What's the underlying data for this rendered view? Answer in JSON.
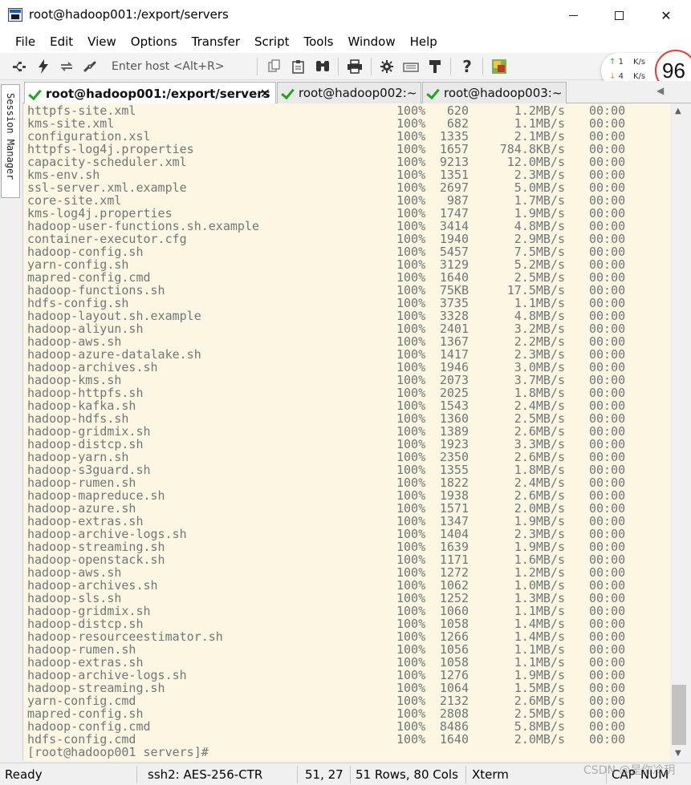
{
  "window": {
    "title": "root@hadoop001:/export/servers",
    "controls": {
      "minimize": "minimize",
      "maximize": "maximize",
      "close": "✕"
    }
  },
  "menu": [
    "File",
    "Edit",
    "View",
    "Options",
    "Transfer",
    "Script",
    "Tools",
    "Window",
    "Help"
  ],
  "toolbar": {
    "host_placeholder": "Enter host <Alt+R>",
    "icons": [
      "connect-icon",
      "quick-connect-icon",
      "reconnect-icon",
      "disconnect-icon",
      "copy-icon",
      "paste-icon",
      "find-icon",
      "print-icon",
      "settings-icon",
      "keymap-icon",
      "sftp-icon",
      "help-icon",
      "sessions-icon"
    ]
  },
  "network": {
    "up_value": "1",
    "up_unit": "K/s",
    "down_value": "4",
    "down_unit": "K/s",
    "gauge": "96"
  },
  "tabs": [
    {
      "label": "root@hadoop001:/export/servers",
      "active": true,
      "close": "✕"
    },
    {
      "label": "root@hadoop002:~",
      "active": false
    },
    {
      "label": "root@hadoop003:~",
      "active": false
    }
  ],
  "session_manager": {
    "label": "Session Manager"
  },
  "terminal": {
    "rows": [
      {
        "name": "httpfs-site.xml",
        "pct": "100%",
        "size": "620",
        "rate": "1.2MB/s",
        "time": "00:00"
      },
      {
        "name": "kms-site.xml",
        "pct": "100%",
        "size": "682",
        "rate": "1.1MB/s",
        "time": "00:00"
      },
      {
        "name": "configuration.xsl",
        "pct": "100%",
        "size": "1335",
        "rate": "2.1MB/s",
        "time": "00:00"
      },
      {
        "name": "httpfs-log4j.properties",
        "pct": "100%",
        "size": "1657",
        "rate": "784.8KB/s",
        "time": "00:00"
      },
      {
        "name": "capacity-scheduler.xml",
        "pct": "100%",
        "size": "9213",
        "rate": "12.0MB/s",
        "time": "00:00"
      },
      {
        "name": "kms-env.sh",
        "pct": "100%",
        "size": "1351",
        "rate": "2.3MB/s",
        "time": "00:00"
      },
      {
        "name": "ssl-server.xml.example",
        "pct": "100%",
        "size": "2697",
        "rate": "5.0MB/s",
        "time": "00:00"
      },
      {
        "name": "core-site.xml",
        "pct": "100%",
        "size": "987",
        "rate": "1.7MB/s",
        "time": "00:00"
      },
      {
        "name": "kms-log4j.properties",
        "pct": "100%",
        "size": "1747",
        "rate": "1.9MB/s",
        "time": "00:00"
      },
      {
        "name": "hadoop-user-functions.sh.example",
        "pct": "100%",
        "size": "3414",
        "rate": "4.8MB/s",
        "time": "00:00"
      },
      {
        "name": "container-executor.cfg",
        "pct": "100%",
        "size": "1940",
        "rate": "2.9MB/s",
        "time": "00:00"
      },
      {
        "name": "hadoop-config.sh",
        "pct": "100%",
        "size": "5457",
        "rate": "7.5MB/s",
        "time": "00:00"
      },
      {
        "name": "yarn-config.sh",
        "pct": "100%",
        "size": "3129",
        "rate": "5.2MB/s",
        "time": "00:00"
      },
      {
        "name": "mapred-config.cmd",
        "pct": "100%",
        "size": "1640",
        "rate": "2.5MB/s",
        "time": "00:00"
      },
      {
        "name": "hadoop-functions.sh",
        "pct": "100%",
        "size": "75KB",
        "rate": "17.5MB/s",
        "time": "00:00"
      },
      {
        "name": "hdfs-config.sh",
        "pct": "100%",
        "size": "3735",
        "rate": "1.1MB/s",
        "time": "00:00"
      },
      {
        "name": "hadoop-layout.sh.example",
        "pct": "100%",
        "size": "3328",
        "rate": "4.8MB/s",
        "time": "00:00"
      },
      {
        "name": "hadoop-aliyun.sh",
        "pct": "100%",
        "size": "2401",
        "rate": "3.2MB/s",
        "time": "00:00"
      },
      {
        "name": "hadoop-aws.sh",
        "pct": "100%",
        "size": "1367",
        "rate": "2.2MB/s",
        "time": "00:00"
      },
      {
        "name": "hadoop-azure-datalake.sh",
        "pct": "100%",
        "size": "1417",
        "rate": "2.3MB/s",
        "time": "00:00"
      },
      {
        "name": "hadoop-archives.sh",
        "pct": "100%",
        "size": "1946",
        "rate": "3.0MB/s",
        "time": "00:00"
      },
      {
        "name": "hadoop-kms.sh",
        "pct": "100%",
        "size": "2073",
        "rate": "3.7MB/s",
        "time": "00:00"
      },
      {
        "name": "hadoop-httpfs.sh",
        "pct": "100%",
        "size": "2025",
        "rate": "1.8MB/s",
        "time": "00:00"
      },
      {
        "name": "hadoop-kafka.sh",
        "pct": "100%",
        "size": "1543",
        "rate": "2.4MB/s",
        "time": "00:00"
      },
      {
        "name": "hadoop-hdfs.sh",
        "pct": "100%",
        "size": "1360",
        "rate": "2.5MB/s",
        "time": "00:00"
      },
      {
        "name": "hadoop-gridmix.sh",
        "pct": "100%",
        "size": "1389",
        "rate": "2.6MB/s",
        "time": "00:00"
      },
      {
        "name": "hadoop-distcp.sh",
        "pct": "100%",
        "size": "1923",
        "rate": "3.3MB/s",
        "time": "00:00"
      },
      {
        "name": "hadoop-yarn.sh",
        "pct": "100%",
        "size": "2350",
        "rate": "2.6MB/s",
        "time": "00:00"
      },
      {
        "name": "hadoop-s3guard.sh",
        "pct": "100%",
        "size": "1355",
        "rate": "1.8MB/s",
        "time": "00:00"
      },
      {
        "name": "hadoop-rumen.sh",
        "pct": "100%",
        "size": "1822",
        "rate": "2.4MB/s",
        "time": "00:00"
      },
      {
        "name": "hadoop-mapreduce.sh",
        "pct": "100%",
        "size": "1938",
        "rate": "2.6MB/s",
        "time": "00:00"
      },
      {
        "name": "hadoop-azure.sh",
        "pct": "100%",
        "size": "1571",
        "rate": "2.0MB/s",
        "time": "00:00"
      },
      {
        "name": "hadoop-extras.sh",
        "pct": "100%",
        "size": "1347",
        "rate": "1.9MB/s",
        "time": "00:00"
      },
      {
        "name": "hadoop-archive-logs.sh",
        "pct": "100%",
        "size": "1404",
        "rate": "2.3MB/s",
        "time": "00:00"
      },
      {
        "name": "hadoop-streaming.sh",
        "pct": "100%",
        "size": "1639",
        "rate": "1.9MB/s",
        "time": "00:00"
      },
      {
        "name": "hadoop-openstack.sh",
        "pct": "100%",
        "size": "1171",
        "rate": "1.6MB/s",
        "time": "00:00"
      },
      {
        "name": "hadoop-aws.sh",
        "pct": "100%",
        "size": "1272",
        "rate": "1.2MB/s",
        "time": "00:00"
      },
      {
        "name": "hadoop-archives.sh",
        "pct": "100%",
        "size": "1062",
        "rate": "1.0MB/s",
        "time": "00:00"
      },
      {
        "name": "hadoop-sls.sh",
        "pct": "100%",
        "size": "1252",
        "rate": "1.3MB/s",
        "time": "00:00"
      },
      {
        "name": "hadoop-gridmix.sh",
        "pct": "100%",
        "size": "1060",
        "rate": "1.1MB/s",
        "time": "00:00"
      },
      {
        "name": "hadoop-distcp.sh",
        "pct": "100%",
        "size": "1058",
        "rate": "1.4MB/s",
        "time": "00:00"
      },
      {
        "name": "hadoop-resourceestimator.sh",
        "pct": "100%",
        "size": "1266",
        "rate": "1.4MB/s",
        "time": "00:00"
      },
      {
        "name": "hadoop-rumen.sh",
        "pct": "100%",
        "size": "1056",
        "rate": "1.1MB/s",
        "time": "00:00"
      },
      {
        "name": "hadoop-extras.sh",
        "pct": "100%",
        "size": "1058",
        "rate": "1.1MB/s",
        "time": "00:00"
      },
      {
        "name": "hadoop-archive-logs.sh",
        "pct": "100%",
        "size": "1276",
        "rate": "1.9MB/s",
        "time": "00:00"
      },
      {
        "name": "hadoop-streaming.sh",
        "pct": "100%",
        "size": "1064",
        "rate": "1.5MB/s",
        "time": "00:00"
      },
      {
        "name": "yarn-config.cmd",
        "pct": "100%",
        "size": "2132",
        "rate": "2.6MB/s",
        "time": "00:00"
      },
      {
        "name": "mapred-config.sh",
        "pct": "100%",
        "size": "2808",
        "rate": "2.5MB/s",
        "time": "00:00"
      },
      {
        "name": "hadoop-config.cmd",
        "pct": "100%",
        "size": "8486",
        "rate": "5.8MB/s",
        "time": "00:00"
      },
      {
        "name": "hdfs-config.cmd",
        "pct": "100%",
        "size": "1640",
        "rate": "2.0MB/s",
        "time": "00:00"
      }
    ],
    "prompt": "[root@hadoop001 servers]#",
    "colors": {
      "background": "#fdf6e3",
      "foreground": "#6f7779"
    }
  },
  "statusbar": {
    "ready": "Ready",
    "protocol": "ssh2: AES-256-CTR",
    "cursor": "51,  27",
    "dimensions": "51 Rows, 80 Cols",
    "terminal_type": "Xterm",
    "caps": "CAP",
    "num": "NUM"
  },
  "watermark": "CSDN @是你冷玥"
}
